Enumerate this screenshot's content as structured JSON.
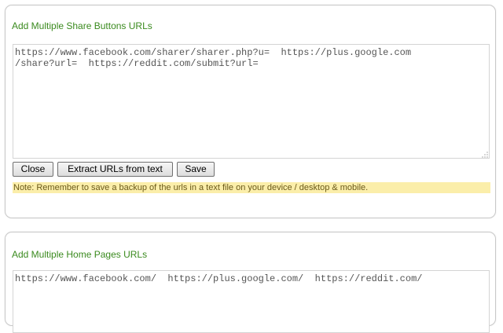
{
  "share_panel": {
    "title": "Add Multiple Share Buttons URLs",
    "urls_text": "https://www.facebook.com/sharer/sharer.php?u=  https://plus.google.com\n/share?url=  https://reddit.com/submit?url=",
    "buttons": {
      "close_label": "Close",
      "extract_label": "Extract URLs from text",
      "save_label": "Save"
    },
    "note": "Note: Remember to save a backup of the urls in a text file on your device / desktop & mobile."
  },
  "home_panel": {
    "title": "Add Multiple Home Pages URLs",
    "urls_text": "https://www.facebook.com/  https://plus.google.com/  https://reddit.com/"
  },
  "colors": {
    "title_green": "#3a8a1e",
    "note_background": "#fbeeaa"
  }
}
